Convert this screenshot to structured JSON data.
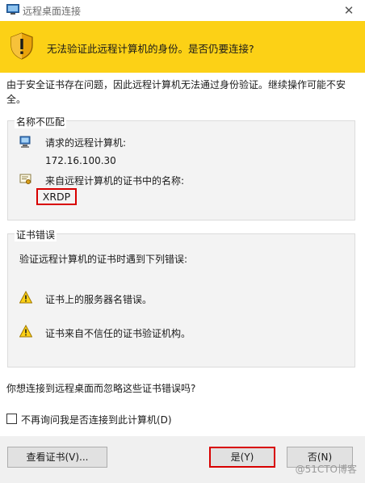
{
  "window": {
    "title": "远程桌面连接",
    "close_label": "✕"
  },
  "banner": {
    "text": "无法验证此远程计算机的身份。是否仍要连接?"
  },
  "intro": {
    "text": "由于安全证书存在问题，因此远程计算机无法通过身份验证。继续操作可能不安全。"
  },
  "name_mismatch": {
    "legend": "名称不匹配",
    "requested_label": "请求的远程计算机:",
    "requested_value": "172.16.100.30",
    "cert_name_label": "来自远程计算机的证书中的名称:",
    "cert_name_value": "XRDP"
  },
  "cert_errors": {
    "legend": "证书错误",
    "intro": "验证远程计算机的证书时遇到下列错误:",
    "errors": [
      "证书上的服务器名错误。",
      "证书来自不信任的证书验证机构。"
    ]
  },
  "question": "你想连接到远程桌面而忽略这些证书错误吗?",
  "checkbox": {
    "label": "不再询问我是否连接到此计算机(D)",
    "checked": false
  },
  "buttons": {
    "view_cert": "查看证书(V)...",
    "yes": "是(Y)",
    "no": "否(N)"
  },
  "watermark": "@51CTO博客",
  "colors": {
    "banner": "#fcd116",
    "highlight": "#d80000",
    "footer": "#f0f0f0"
  }
}
